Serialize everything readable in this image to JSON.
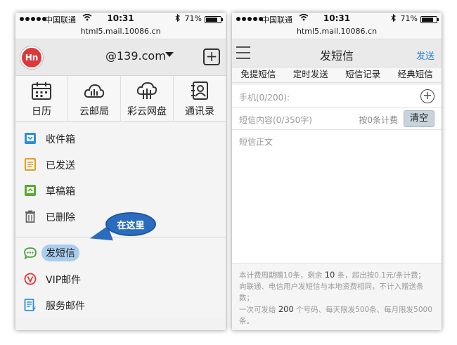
{
  "status": {
    "carrier": "中国联通",
    "time": "10:31",
    "battery_pct": "71%",
    "battery_level": 0.71,
    "url": "html5.mail.10086.cn"
  },
  "left": {
    "avatar": "Hn",
    "account": "@139.com",
    "apps": [
      {
        "label": "日历",
        "icon": "calendar-icon"
      },
      {
        "label": "云邮局",
        "icon": "cloud-mail-icon"
      },
      {
        "label": "彩云网盘",
        "icon": "cloud-drive-icon"
      },
      {
        "label": "通讯录",
        "icon": "contacts-icon"
      }
    ],
    "folders": [
      {
        "label": "收件箱",
        "icon": "inbox-icon"
      },
      {
        "label": "已发送",
        "icon": "sent-icon"
      },
      {
        "label": "草稿箱",
        "icon": "drafts-icon"
      },
      {
        "label": "已删除",
        "icon": "trash-icon"
      }
    ],
    "services": [
      {
        "label": "发短信",
        "icon": "sms-icon"
      },
      {
        "label": "VIP邮件",
        "icon": "vip-icon"
      },
      {
        "label": "服务邮件",
        "icon": "service-mail-icon"
      }
    ],
    "callout": "在这里"
  },
  "right": {
    "title": "发短信",
    "send": "发送",
    "tabs": [
      "免提短信",
      "定时发送",
      "短信记录",
      "经典短信"
    ],
    "phone_placeholder": "手机(0/200):",
    "content_placeholder": "短信内容(0/350字)",
    "billing_note": "按0条计费",
    "clear": "清空",
    "body_placeholder": "短信正文",
    "footer": {
      "line1_a": "本计费周期赠10条，剩余",
      "line1_num": "10",
      "line1_b": "条，超出按0.1元/条计费；",
      "line2": "向联通、电信用户发短信与本地资费相同，不计入赠送条数；",
      "line3_a": "一次可发给",
      "line3_num": "200",
      "line3_b": "个号码、每天限发500条、每月限发5000条。"
    }
  }
}
